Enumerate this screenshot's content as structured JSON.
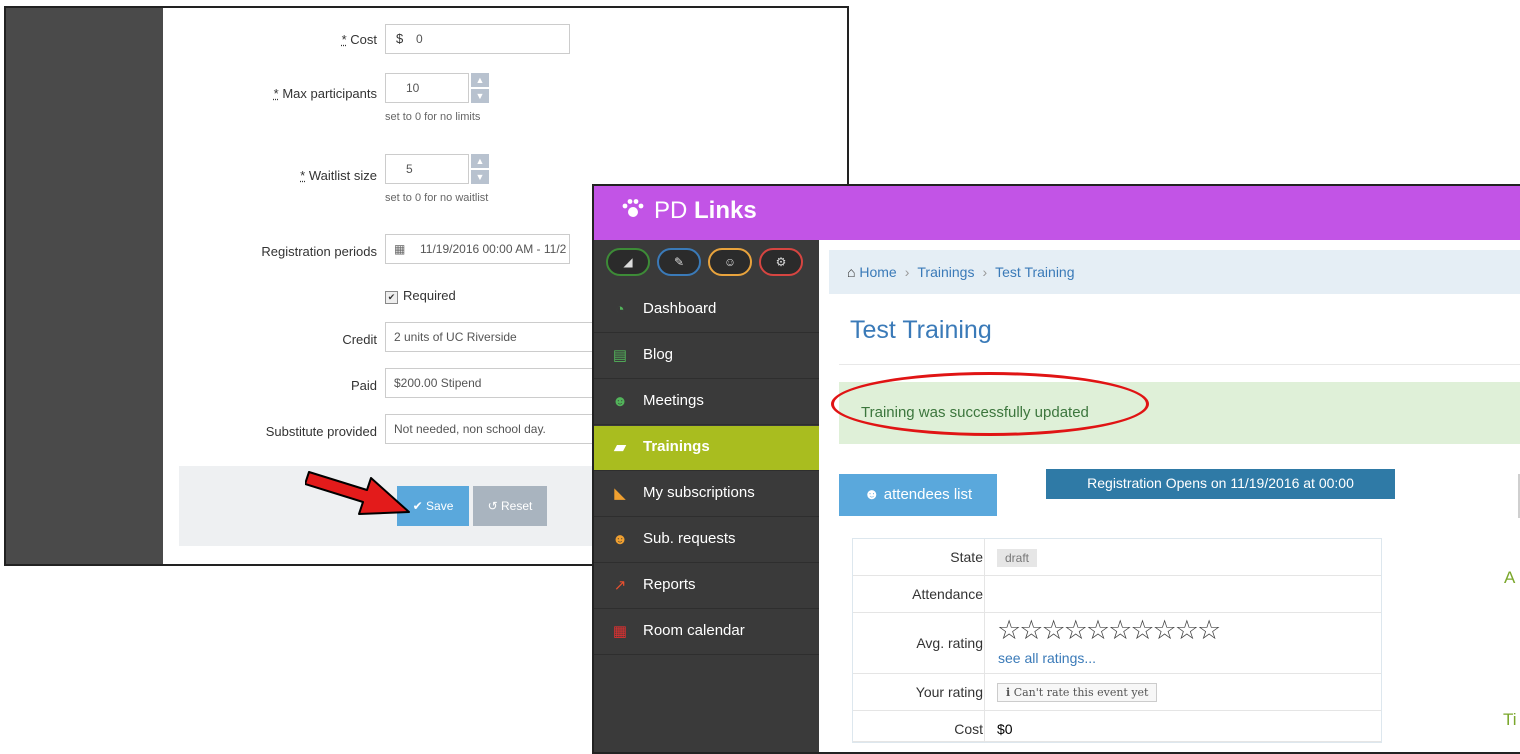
{
  "form": {
    "cost": {
      "label": "Cost",
      "required_mark": "*",
      "prefix": "$",
      "value": "0"
    },
    "max_participants": {
      "label": "Max participants",
      "required_mark": "*",
      "value": "10",
      "hint": "set to 0 for no limits"
    },
    "waitlist_size": {
      "label": "Waitlist size",
      "required_mark": "*",
      "value": "5",
      "hint": "set to 0 for no waitlist"
    },
    "registration_periods": {
      "label": "Registration periods",
      "value": "11/19/2016 00:00 AM - 11/2"
    },
    "required": {
      "label": "Required",
      "checked": true
    },
    "credit": {
      "label": "Credit",
      "value": "2 units of UC Riverside"
    },
    "paid": {
      "label": "Paid",
      "value": "$200.00 Stipend"
    },
    "substitute": {
      "label": "Substitute provided",
      "value": "Not needed, non school day."
    },
    "save_label": "Save",
    "reset_label": "Reset"
  },
  "app": {
    "brand_plain": "PD ",
    "brand_bold": "Links",
    "colors": {
      "appbar": "#c254e6",
      "active_nav": "#a9bd1f",
      "link": "#3a7ab8",
      "success_bg": "#dff0d8",
      "annotation": "#e01414"
    }
  },
  "toolbar_icons": [
    {
      "name": "signal-icon",
      "glyph": "◢",
      "color": "#3d8b37"
    },
    {
      "name": "pencil-icon",
      "glyph": "✎",
      "color": "#3a7ab8"
    },
    {
      "name": "users-icon",
      "glyph": "☺",
      "color": "#e8a33d"
    },
    {
      "name": "gears-icon",
      "glyph": "⚙",
      "color": "#d64541"
    }
  ],
  "nav": [
    {
      "label": "Dashboard",
      "icon": "dashboard-icon",
      "glyph": "◔",
      "color": "#52b35a"
    },
    {
      "label": "Blog",
      "icon": "blog-icon",
      "glyph": "▤",
      "color": "#52b35a"
    },
    {
      "label": "Meetings",
      "icon": "meetings-icon",
      "glyph": "☻",
      "color": "#52b35a"
    },
    {
      "label": "Trainings",
      "icon": "trainings-icon",
      "glyph": "▰",
      "color": "#ffffff",
      "active": true
    },
    {
      "label": "My subscriptions",
      "icon": "rss-icon",
      "glyph": "◣",
      "color": "#f0a030"
    },
    {
      "label": "Sub. requests",
      "icon": "user-remove-icon",
      "glyph": "☻",
      "color": "#f0a030"
    },
    {
      "label": "Reports",
      "icon": "reports-icon",
      "glyph": "↗",
      "color": "#e8502f"
    },
    {
      "label": "Room calendar",
      "icon": "calendar-icon",
      "glyph": "▦",
      "color": "#e03030"
    }
  ],
  "breadcrumb": {
    "home": "Home",
    "trainings": "Trainings",
    "current": "Test Training"
  },
  "page_title": "Test Training",
  "alert": "Training was successfully updated",
  "attendees_btn": "attendees list",
  "registration_badge": "Registration Opens on 11/19/2016 at 00:00",
  "details": {
    "state_label": "State",
    "state_value": "draft",
    "attendance_label": "Attendance",
    "avg_rating_label": "Avg. rating",
    "stars_total": 10,
    "stars_filled": 0,
    "see_all": "see all ratings...",
    "your_rating_label": "Your rating",
    "cant_rate": "Can't rate this event yet",
    "cost_label": "Cost",
    "cost_value": "$0"
  },
  "right_cut": {
    "a": "A",
    "t": "Ti"
  }
}
